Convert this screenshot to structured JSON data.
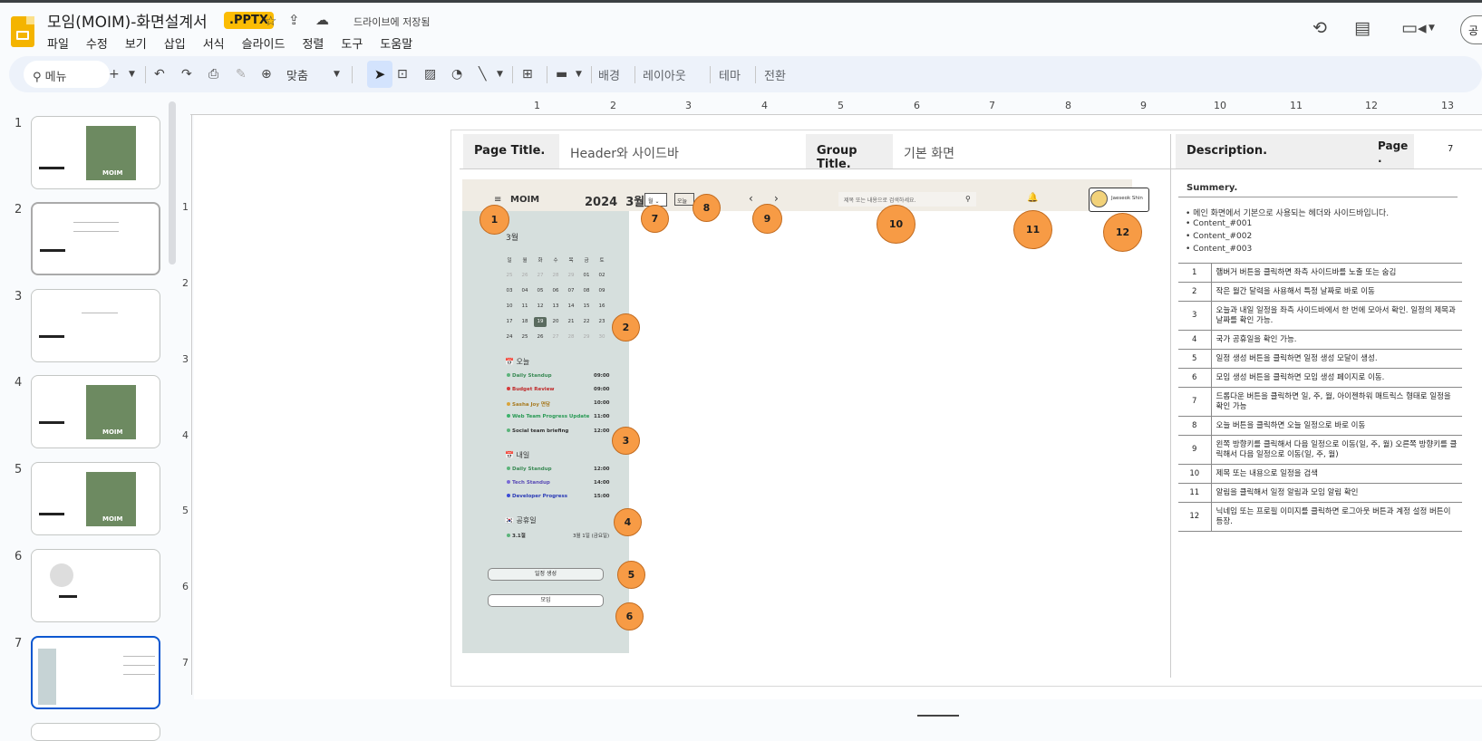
{
  "doc": {
    "title": "모임(MOIM)-화면설계서",
    "format_badge": ".PPTX",
    "saved_status": "드라이브에 저장됨",
    "share_label": "공"
  },
  "menu": [
    "파일",
    "수정",
    "보기",
    "삽입",
    "서식",
    "슬라이드",
    "정렬",
    "도구",
    "도움말"
  ],
  "toolbar": {
    "search_label": "메뉴",
    "zoom_label": "맞춤",
    "background": "배경",
    "layout": "레이아웃",
    "theme": "테마",
    "transition": "전환"
  },
  "filmstrip": {
    "numbers": [
      "1",
      "2",
      "3",
      "4",
      "5",
      "6",
      "7"
    ],
    "selected": "7",
    "moim_label": "MOIM"
  },
  "rulers": {
    "h": [
      "1",
      "2",
      "3",
      "4",
      "5",
      "6",
      "7",
      "8",
      "9",
      "10",
      "11",
      "12",
      "13"
    ],
    "v": [
      "1",
      "2",
      "3",
      "4",
      "5",
      "6",
      "7"
    ]
  },
  "slide": {
    "page_title_label": "Page Title.",
    "page_title_value": "Header와 사이드바",
    "group_title_label": "Group Title.",
    "group_title_value": "기본 화면",
    "description_label": "Description.",
    "page_label": "Page .",
    "page_number": "7"
  },
  "app": {
    "menu_icon": "≡",
    "logo": "MOIM",
    "year_month": "2024  3월",
    "view_select": "월",
    "today_btn": "오늘",
    "prev": "‹",
    "next": "›",
    "search_placeholder": "제목 또는 내용으로 검색하세요.",
    "user_name": "Jaeseok Shin",
    "month_label": "3월",
    "weekdays": [
      "일",
      "월",
      "화",
      "수",
      "목",
      "금",
      "토"
    ],
    "days": [
      [
        "25",
        "26",
        "27",
        "28",
        "29",
        "01",
        "02"
      ],
      [
        "03",
        "04",
        "05",
        "06",
        "07",
        "08",
        "09"
      ],
      [
        "10",
        "11",
        "12",
        "13",
        "14",
        "15",
        "16"
      ],
      [
        "17",
        "18",
        "19",
        "20",
        "21",
        "22",
        "23"
      ],
      [
        "24",
        "25",
        "26",
        "27",
        "28",
        "29",
        "30"
      ]
    ],
    "today_label": "📅 오늘",
    "today_events": [
      {
        "name": "Daily Standup",
        "time": "09:00",
        "color": "#5bb47a"
      },
      {
        "name": "Budget Review",
        "time": "09:00",
        "color": "#d63b3b"
      },
      {
        "name": "Sasha Joy 면담",
        "time": "10:00",
        "color": "#d9a43a"
      },
      {
        "name": "Web Team Progress Update",
        "time": "11:00",
        "color": "#3bb36b"
      },
      {
        "name": "Social team briefing",
        "time": "12:00",
        "color": "#555555"
      }
    ],
    "tomorrow_label": "📅 내일",
    "tomorrow_events": [
      {
        "name": "Daily Standup",
        "time": "12:00",
        "color": "#5bb47a"
      },
      {
        "name": "Tech Standup",
        "time": "14:00",
        "color": "#7a6bd6"
      },
      {
        "name": "Developer Progress",
        "time": "15:00",
        "color": "#3b4bd6"
      }
    ],
    "holiday_label": "🇰🇷 공휴일",
    "holidays": [
      {
        "name": "3.1절",
        "date": "3월 1일 (금요일)",
        "color": "#5bb47a"
      }
    ],
    "create_event_btn": "일정 생성",
    "create_moim_btn": "모임"
  },
  "markers": [
    "1",
    "2",
    "3",
    "4",
    "5",
    "6",
    "7",
    "8",
    "9",
    "10",
    "11",
    "12"
  ],
  "summary": {
    "title": "Summery.",
    "bullets": [
      "메인 화면에서 기본으로 사용되는 헤더와 사이드바입니다.",
      "Content_#001",
      "Content_#002",
      "Content_#003"
    ]
  },
  "descriptions": [
    {
      "n": "1",
      "text": "햄버거 버튼을 클릭하면 좌측 사이드바를 노출 또는 숨김"
    },
    {
      "n": "2",
      "text": "작은 월간 달력을 사용해서 특정 날짜로 바로 이동"
    },
    {
      "n": "3",
      "text": "오늘과 내일 일정을 좌측 사이드바에서 한 번에 모아서 확인. 일정의 제목과 날짜를 확인 가능."
    },
    {
      "n": "4",
      "text": "국가 공휴일을 확인 가능."
    },
    {
      "n": "5",
      "text": "일정 생성 버튼을 클릭하면 일정 생성 모달이 생성."
    },
    {
      "n": "6",
      "text": "모임 생성 버튼을 클릭하면 모임 생성 페이지로 이동."
    },
    {
      "n": "7",
      "text": "드롭다운 버튼을 클릭하면 일, 주, 월, 아이젠하워 매트릭스 형태로 일정을 확인 가능"
    },
    {
      "n": "8",
      "text": "오늘 버튼을 클릭하면 오늘 일정으로 바로 이동"
    },
    {
      "n": "9",
      "text": "왼쪽 방향키를 클릭해서 다음 일정으로 이동(일, 주, 월) 오른쪽 방향키를 클릭해서 다음 일정으로 이동(일, 주, 월)"
    },
    {
      "n": "10",
      "text": "제목 또는 내용으로 일정을 검색"
    },
    {
      "n": "11",
      "text": "알림을 클릭해서 일정 알림과 모임 알림 확인"
    },
    {
      "n": "12",
      "text": "닉네임 또는 프로필 이미지를 클릭하면 로그아웃 버튼과 계정 설정 버튼이 등장."
    }
  ]
}
